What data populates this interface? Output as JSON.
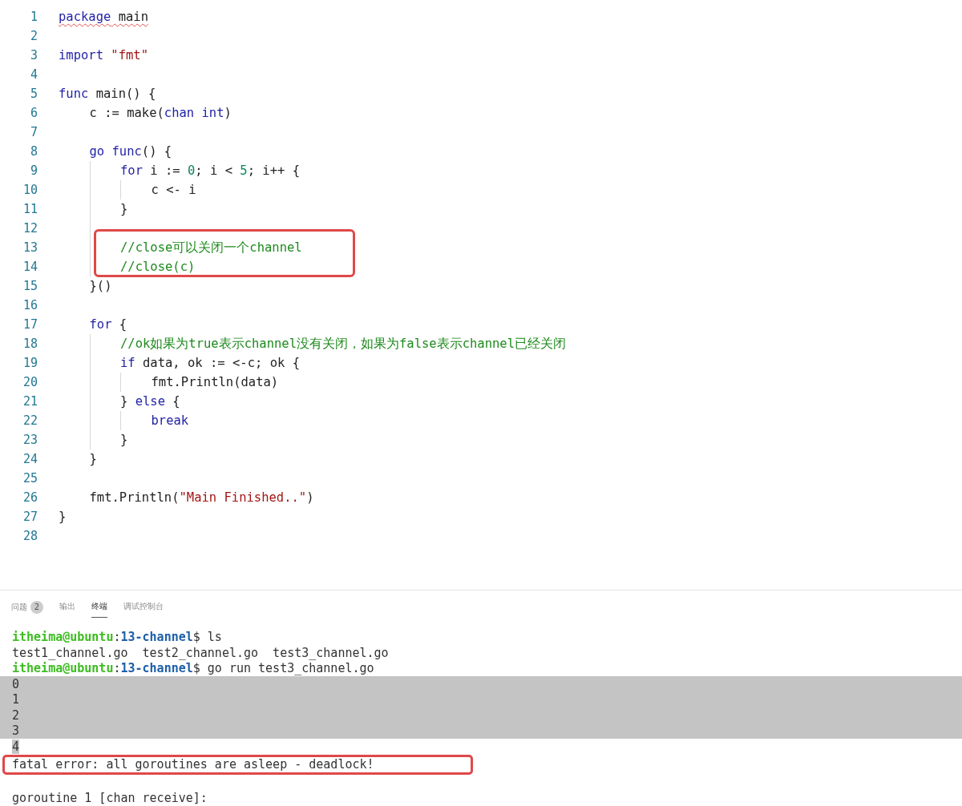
{
  "editor": {
    "lines": [
      {
        "number": "1",
        "squiggle": true,
        "tokens": [
          {
            "kind": "keyword",
            "text": "package"
          },
          {
            "kind": "plain",
            "text": " main"
          }
        ]
      },
      {
        "number": "2"
      },
      {
        "number": "3",
        "tokens": [
          {
            "kind": "keyword",
            "text": "import"
          },
          {
            "kind": "string",
            "text": " \"fmt\""
          }
        ]
      },
      {
        "number": "4"
      },
      {
        "number": "5",
        "tokens": [
          {
            "kind": "keyword",
            "text": "func"
          },
          {
            "kind": "plain",
            "text": " main() {"
          }
        ],
        "children": [
          {
            "number": "6",
            "tokens": [
              {
                "kind": "plain",
                "text": "c := make("
              },
              {
                "kind": "keyword",
                "text": "chan"
              },
              {
                "kind": "keyword",
                "text": " int"
              },
              {
                "kind": "plain",
                "text": ")"
              }
            ]
          },
          {
            "number": "7"
          },
          {
            "number": "8",
            "tokens": [
              {
                "kind": "keyword",
                "text": "go"
              },
              {
                "kind": "keyword",
                "text": " func"
              },
              {
                "kind": "plain",
                "text": "() {"
              }
            ],
            "children": [
              {
                "number": "9",
                "tokens": [
                  {
                    "kind": "keyword",
                    "text": "for"
                  },
                  {
                    "kind": "plain",
                    "text": " i := "
                  },
                  {
                    "kind": "number",
                    "text": "0"
                  },
                  {
                    "kind": "plain",
                    "text": "; i < "
                  },
                  {
                    "kind": "number",
                    "text": "5"
                  },
                  {
                    "kind": "plain",
                    "text": "; i++ {"
                  }
                ],
                "children": [
                  {
                    "number": "10",
                    "tokens": [
                      {
                        "kind": "plain",
                        "text": "c <- i"
                      }
                    ]
                  }
                ]
              },
              {
                "number": "11",
                "tokens": [
                  {
                    "kind": "plain",
                    "text": "}"
                  }
                ]
              },
              {
                "number": "12"
              },
              {
                "number": "13",
                "boxed": true,
                "tokens": [
                  {
                    "kind": "comment",
                    "text": "//close可以关闭一个channel"
                  }
                ]
              },
              {
                "number": "14",
                "boxed": true,
                "tokens": [
                  {
                    "kind": "comment",
                    "text": "//close(c)"
                  }
                ]
              }
            ]
          },
          {
            "number": "15",
            "tokens": [
              {
                "kind": "plain",
                "text": "}()"
              }
            ]
          },
          {
            "number": "16"
          },
          {
            "number": "17",
            "tokens": [
              {
                "kind": "keyword",
                "text": "for"
              },
              {
                "kind": "plain",
                "text": " {"
              }
            ],
            "children": [
              {
                "number": "18",
                "tokens": [
                  {
                    "kind": "comment",
                    "text": "//ok如果为true表示channel没有关闭，如果为false表示channel已经关闭"
                  }
                ]
              },
              {
                "number": "19",
                "tokens": [
                  {
                    "kind": "keyword",
                    "text": "if"
                  },
                  {
                    "kind": "plain",
                    "text": " data, ok := <-c; ok {"
                  }
                ],
                "children": [
                  {
                    "number": "20",
                    "tokens": [
                      {
                        "kind": "plain",
                        "text": "fmt.Println(data)"
                      }
                    ]
                  }
                ]
              },
              {
                "number": "21",
                "tokens": [
                  {
                    "kind": "plain",
                    "text": "} "
                  },
                  {
                    "kind": "keyword",
                    "text": "else"
                  },
                  {
                    "kind": "plain",
                    "text": " {"
                  }
                ],
                "children": [
                  {
                    "number": "22",
                    "tokens": [
                      {
                        "kind": "keyword",
                        "text": "break"
                      }
                    ]
                  }
                ]
              },
              {
                "number": "23",
                "tokens": [
                  {
                    "kind": "plain",
                    "text": "}"
                  }
                ]
              }
            ]
          },
          {
            "number": "24",
            "tokens": [
              {
                "kind": "plain",
                "text": "}"
              }
            ]
          },
          {
            "number": "25"
          },
          {
            "number": "26",
            "tokens": [
              {
                "kind": "plain",
                "text": "fmt.Println("
              },
              {
                "kind": "string",
                "text": "\"Main Finished..\""
              },
              {
                "kind": "plain",
                "text": ")"
              }
            ]
          }
        ]
      },
      {
        "number": "27",
        "tokens": [
          {
            "kind": "plain",
            "text": "}"
          }
        ]
      },
      {
        "number": "28"
      }
    ]
  },
  "panel": {
    "tabs": [
      {
        "label": "问题",
        "badge": "2",
        "selected": false
      },
      {
        "label": "输出",
        "selected": false
      },
      {
        "label": "终端",
        "selected": true
      },
      {
        "label": "调试控制台",
        "selected": false
      }
    ],
    "terminal": [
      {
        "kind": "prompt",
        "user": "itheima@ubuntu",
        "separator": ":",
        "path": "13-channel",
        "command": "$ ls"
      },
      {
        "kind": "output",
        "text": "test1_channel.go  test2_channel.go  test3_channel.go"
      },
      {
        "kind": "prompt",
        "user": "itheima@ubuntu",
        "separator": ":",
        "path": "13-channel",
        "command": "$ go run test3_channel.go"
      },
      {
        "kind": "output",
        "text": "0",
        "selected": true
      },
      {
        "kind": "output",
        "text": "1",
        "selected": true
      },
      {
        "kind": "output",
        "text": "2",
        "selected": true
      },
      {
        "kind": "output",
        "text": "3",
        "selected": true
      },
      {
        "kind": "output",
        "text": "4",
        "selected": true
      },
      {
        "kind": "output",
        "text": "fatal error: all goroutines are asleep - deadlock!",
        "boxed": true
      },
      {
        "kind": "blank"
      },
      {
        "kind": "output",
        "text": "goroutine 1 [chan receive]:"
      }
    ]
  }
}
